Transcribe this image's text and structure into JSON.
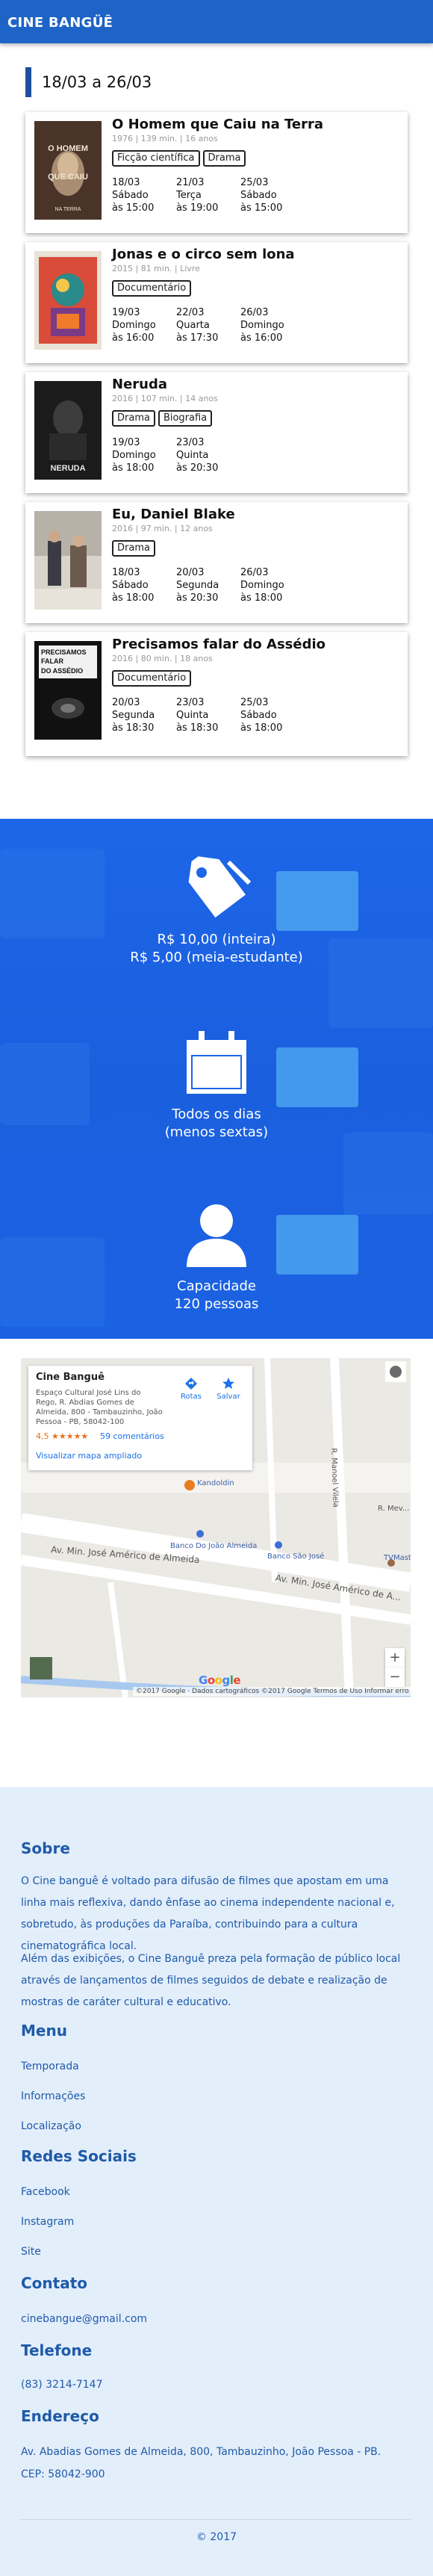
{
  "header": {
    "title": "CINE BANGÜÊ"
  },
  "week": {
    "label": "18/03 a 26/03"
  },
  "movies": [
    {
      "title": "O Homem que Caiu na Terra",
      "meta": "1976 | 139 min. | 16 anos",
      "tags": [
        "Ficção científica",
        "Drama"
      ],
      "poster_text": [
        "O HOMEM",
        "QUE CAIU"
      ],
      "poster_caption": "NA TERRA",
      "sessions": [
        {
          "date": "18/03",
          "day": "Sábado",
          "time": "às 15:00"
        },
        {
          "date": "21/03",
          "day": "Terça",
          "time": "às 19:00"
        },
        {
          "date": "25/03",
          "day": "Sábado",
          "time": "às 15:00"
        }
      ]
    },
    {
      "title": "Jonas e o circo sem lona",
      "meta": "2015 | 81 min. | Livre",
      "tags": [
        "Documentário"
      ],
      "poster_text": [
        "",
        ""
      ],
      "poster_caption": "",
      "sessions": [
        {
          "date": "19/03",
          "day": "Domingo",
          "time": "às 16:00"
        },
        {
          "date": "22/03",
          "day": "Quarta",
          "time": "às 17:30"
        },
        {
          "date": "26/03",
          "day": "Domingo",
          "time": "às 16:00"
        }
      ]
    },
    {
      "title": "Neruda",
      "meta": "2016 | 107 min. | 14 anos",
      "tags": [
        "Drama",
        "Biografia"
      ],
      "poster_text": [
        "",
        ""
      ],
      "poster_caption": "NERUDA",
      "sessions": [
        {
          "date": "19/03",
          "day": "Domingo",
          "time": "às 18:00"
        },
        {
          "date": "23/03",
          "day": "Quinta",
          "time": "às 20:30"
        }
      ]
    },
    {
      "title": "Eu, Daniel Blake",
      "meta": "2016 | 97 min. | 12 anos",
      "tags": [
        "Drama"
      ],
      "poster_text": [
        "",
        ""
      ],
      "poster_caption": "",
      "sessions": [
        {
          "date": "18/03",
          "day": "Sábado",
          "time": "às 18:00"
        },
        {
          "date": "20/03",
          "day": "Segunda",
          "time": "às 20:30"
        },
        {
          "date": "26/03",
          "day": "Domingo",
          "time": "às 18:00"
        }
      ]
    },
    {
      "title": "Precisamos falar do Assédio",
      "meta": "2016 | 80 min. | 18 anos",
      "tags": [
        "Documentário"
      ],
      "poster_text": [
        "PRECISAMOS",
        "FALAR"
      ],
      "poster_caption": "DO ASSÉDIO",
      "sessions": [
        {
          "date": "20/03",
          "day": "Segunda",
          "time": "às 18:30"
        },
        {
          "date": "23/03",
          "day": "Quinta",
          "time": "às 18:30"
        },
        {
          "date": "25/03",
          "day": "Sábado",
          "time": "às 18:00"
        }
      ]
    }
  ],
  "features": {
    "price_full": "R$ 10,00 (inteira)",
    "price_half": "R$ 5,00 (meia-estudante)",
    "days_line1": "Todos os dias",
    "days_line2": "(menos sextas)",
    "capacity_line1": "Capacidade",
    "capacity_line2": "120 pessoas",
    "icons": [
      "tag-icon",
      "calendar-icon",
      "user-icon"
    ]
  },
  "map": {
    "place_name": "Cine Banguê",
    "place_address": "Espaço Cultural José Lins do Rego, R. Abdias Gomes de Almeida, 800 - Tambauzinho, João Pessoa - PB, 58042-100",
    "rating": "4,5 ★★★★★",
    "reviews": "59 comentários",
    "larger_map": "Visualizar mapa ampliado",
    "routes": "Rotas",
    "save": "Salvar",
    "street_main": "Av. Min. José Américo de Almeida",
    "street_main_right": "Av. Min. José Américo de A...",
    "poi_bank1": "Banco Do João Almeida",
    "poi_bank2": "Banco São José",
    "poi_kandoldin": "Kandoldin",
    "poi_tvmaster": "TVMast...",
    "street_vertical": "R. Manoel Vilela",
    "street_r": "R. Mev...",
    "zoom_in": "+",
    "zoom_out": "−",
    "attribution": "©2017 Google · Dados cartográficos ©2017 Google   Termos de Uso   Informar erro no mapa",
    "google": "Google"
  },
  "footer": {
    "about_title": "Sobre",
    "about_p1": "O Cine banguê é voltado para difusão de filmes que apostam em uma linha mais reflexiva, dando ênfase ao cinema independente nacional e, sobretudo, às produções da Paraíba, contribuindo para a cultura cinematográfica local.",
    "about_p2": "Além das exibições, o Cine Banguê preza pela formação de público local através de lançamentos de filmes seguidos de debate e realização de mostras de caráter cultural e educativo.",
    "menu_title": "Menu",
    "menu_items": [
      "Temporada",
      "Informações",
      "Localização"
    ],
    "social_title": "Redes Sociais",
    "social_items": [
      "Facebook",
      "Instagram",
      "Site"
    ],
    "contact_title": "Contato",
    "contact_email": "cinebangue@gmail.com",
    "phone_title": "Telefone",
    "phone": "(83) 3214-7147",
    "address_title": "Endereço",
    "address_line1": "Av. Abadias Gomes de Almeida, 800, Tambauzinho, João Pessoa - PB.",
    "address_line2": "CEP: 58042-900",
    "copyright": "© 2017"
  },
  "colors": {
    "brand": "#1e63c6",
    "band": "#1d66e8",
    "footer_bg": "#e3eefb",
    "footer_text": "#1e5aa8"
  }
}
